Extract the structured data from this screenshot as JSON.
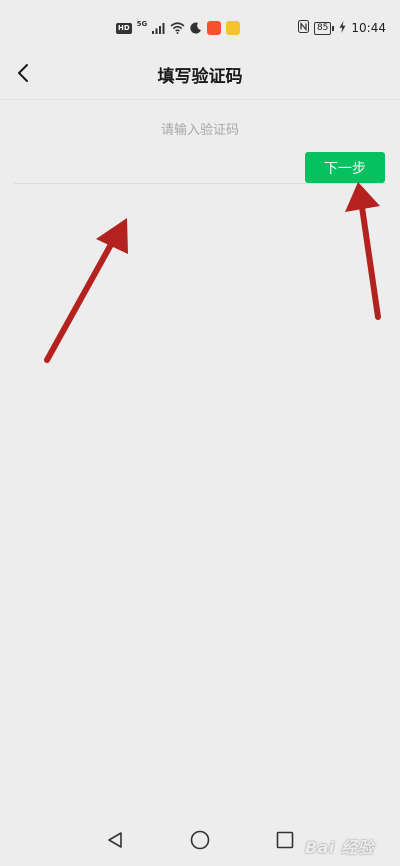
{
  "status_bar": {
    "hd_label": "HD",
    "network_label": "5G",
    "battery_level": "85",
    "time": "10:44",
    "icons": [
      "signal-icon",
      "wifi-icon",
      "moon-icon",
      "nfc-icon",
      "charging-icon"
    ]
  },
  "header": {
    "back_icon": "chevron-left-icon",
    "title": "填写验证码"
  },
  "form": {
    "code_placeholder": "请输入验证码",
    "code_value": "",
    "next_label": "下一步"
  },
  "colors": {
    "background": "#ededed",
    "primary_button": "#07c160",
    "annotation_arrow": "#b3221f"
  },
  "system_nav": {
    "icons": [
      "back-triangle-icon",
      "home-circle-icon",
      "recents-square-icon"
    ]
  },
  "watermark": {
    "text": "Bai 经验"
  }
}
